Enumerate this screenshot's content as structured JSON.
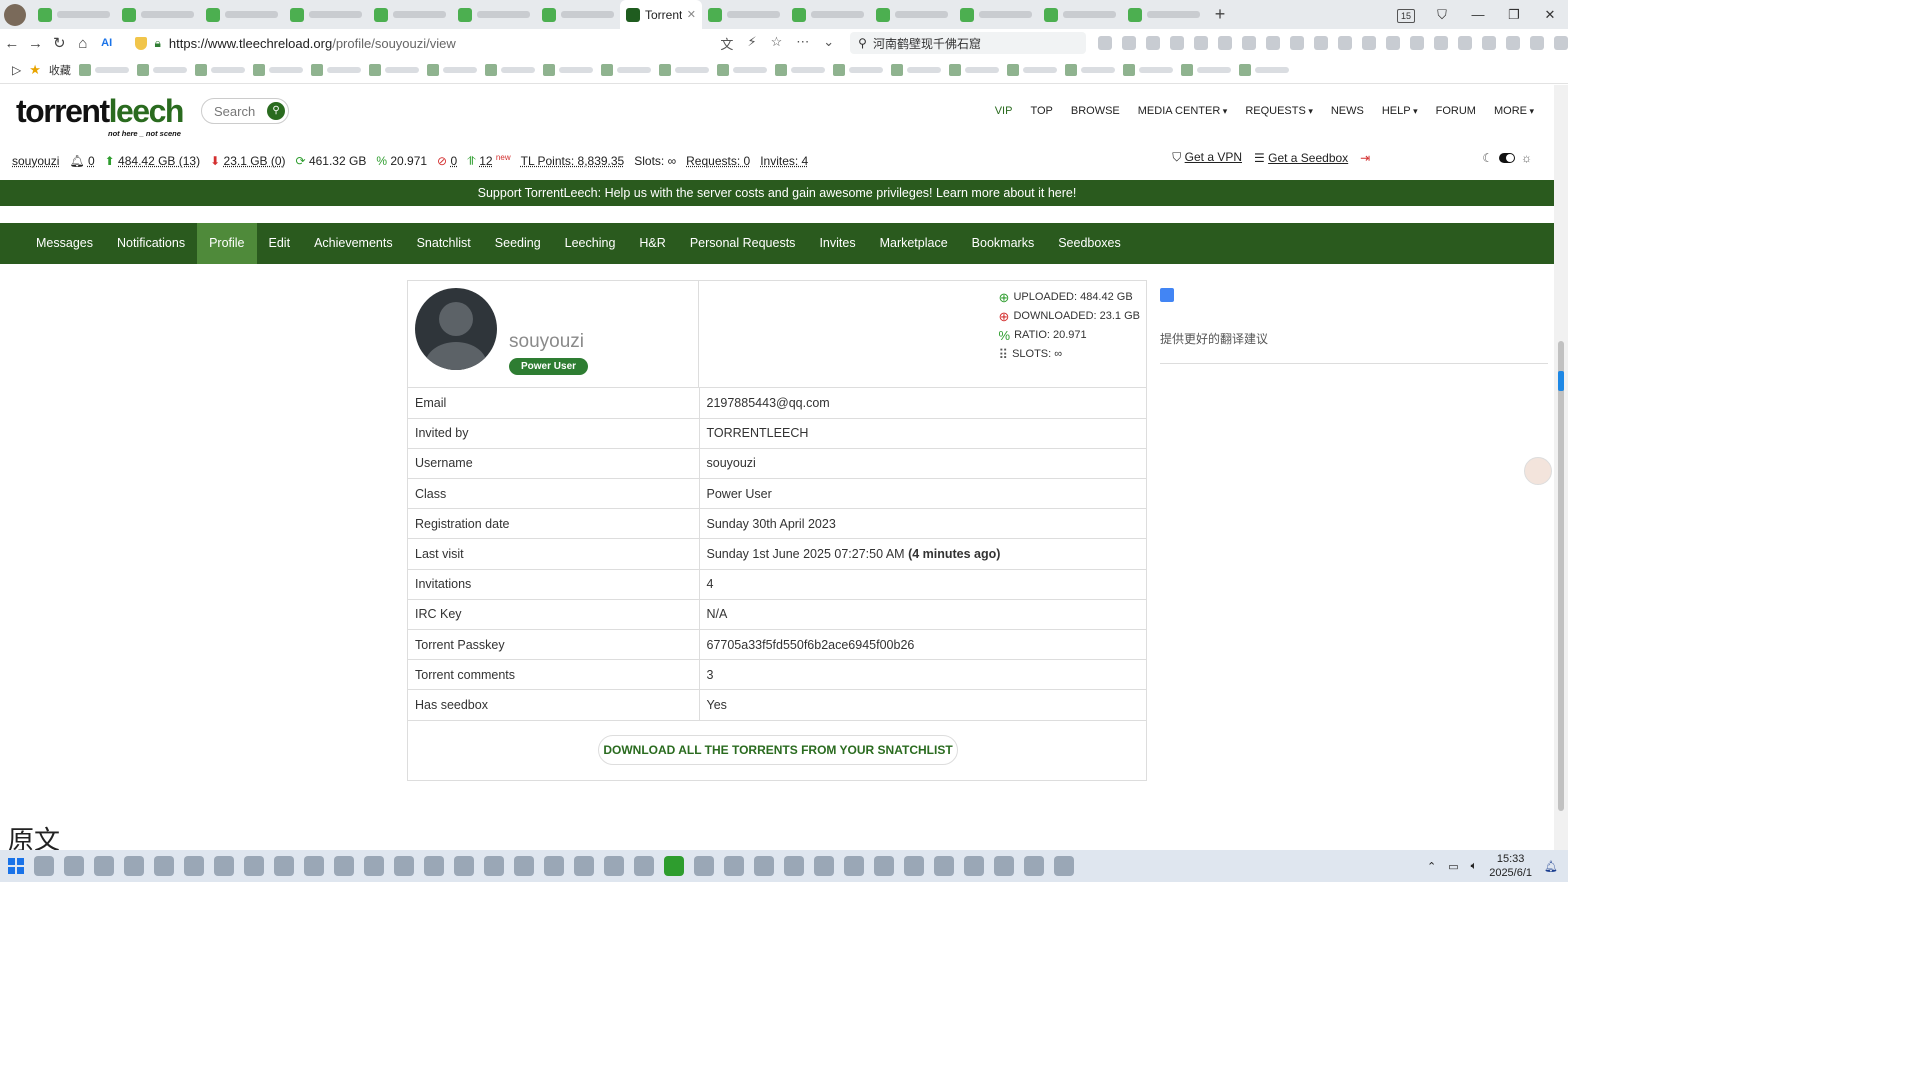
{
  "browser": {
    "active_tab_title": "Torrent",
    "tab_close": "✕",
    "new_tab": "+",
    "tab_count": "15",
    "url_domain": "https://www.tleechreload.org",
    "url_path": "/profile/souyouzi/view",
    "search_query": "河南鹤壁现千佛石窟",
    "bookmarks_label": "收藏"
  },
  "site": {
    "logo_torrent": "torrent",
    "logo_leech": "leech",
    "logo_tagline": "not here _ not scene",
    "search_placeholder": "Search",
    "nav": [
      {
        "label": "VIP"
      },
      {
        "label": "TOP"
      },
      {
        "label": "BROWSE"
      },
      {
        "label": "MEDIA CENTER"
      },
      {
        "label": "REQUESTS"
      },
      {
        "label": "NEWS"
      },
      {
        "label": "HELP"
      },
      {
        "label": "FORUM"
      },
      {
        "label": "MORE"
      }
    ]
  },
  "userbar": {
    "username": "souyouzi",
    "notifications": "0",
    "uploaded": "484.42 GB (13)",
    "downloaded": "23.1 GB (0)",
    "buffer": "461.32 GB",
    "ratio": "20.971",
    "hnr": "0",
    "seeding": "12",
    "seeding_new": "new",
    "tl_points": "TL Points: 8,839.35",
    "slots": "Slots: ∞",
    "requests": "Requests: 0",
    "invites": "Invites: 4",
    "vpn": "Get a VPN",
    "seedbox": "Get a Seedbox"
  },
  "banner": "Support TorrentLeech: Help us with the server costs and gain awesome privileges! Learn more about it here!",
  "profile_nav": [
    {
      "label": "Messages"
    },
    {
      "label": "Notifications"
    },
    {
      "label": "Profile"
    },
    {
      "label": "Edit"
    },
    {
      "label": "Achievements"
    },
    {
      "label": "Snatchlist"
    },
    {
      "label": "Seeding"
    },
    {
      "label": "Leeching"
    },
    {
      "label": "H&R"
    },
    {
      "label": "Personal Requests"
    },
    {
      "label": "Invites"
    },
    {
      "label": "Marketplace"
    },
    {
      "label": "Bookmarks"
    },
    {
      "label": "Seedboxes"
    }
  ],
  "profile": {
    "username": "souyouzi",
    "class_badge": "Power User",
    "stats": {
      "uploaded": "UPLOADED: 484.42 GB",
      "downloaded": "DOWNLOADED:  23.1 GB",
      "ratio": "RATIO: 20.971",
      "slots": "SLOTS: ∞"
    },
    "rows": [
      {
        "key": "Email",
        "value": "2197885443@qq.com"
      },
      {
        "key": "Invited by",
        "value": "TORRENTLEECH"
      },
      {
        "key": "Username",
        "value": "souyouzi"
      },
      {
        "key": "Class",
        "value": "Power User"
      },
      {
        "key": "Registration date",
        "value": "Sunday 30th April 2023"
      },
      {
        "key": "Last visit",
        "value": "Sunday 1st June 2025 07:27:50 AM",
        "extra": "(4 minutes ago)"
      },
      {
        "key": "Invitations",
        "value": "4"
      },
      {
        "key": "IRC Key",
        "value": "N/A"
      },
      {
        "key": "Torrent Passkey",
        "value": "67705a33f5fd550f6b2ace6945f00b26"
      },
      {
        "key": "Torrent comments",
        "value": "3"
      },
      {
        "key": "Has seedbox",
        "value": "Yes"
      }
    ],
    "download_button": "DOWNLOAD ALL THE TORRENTS FROM YOUR SNATCHLIST"
  },
  "translate": {
    "hint": "提供更好的翻译建议"
  },
  "overlay_text": "原文",
  "taskbar": {
    "time": "15:33",
    "date": "2025/6/1"
  },
  "colors": {
    "brand_green": "#2a5a1e",
    "active_tab_green": "#4f8a3a",
    "badge_green": "#2e7d32"
  }
}
